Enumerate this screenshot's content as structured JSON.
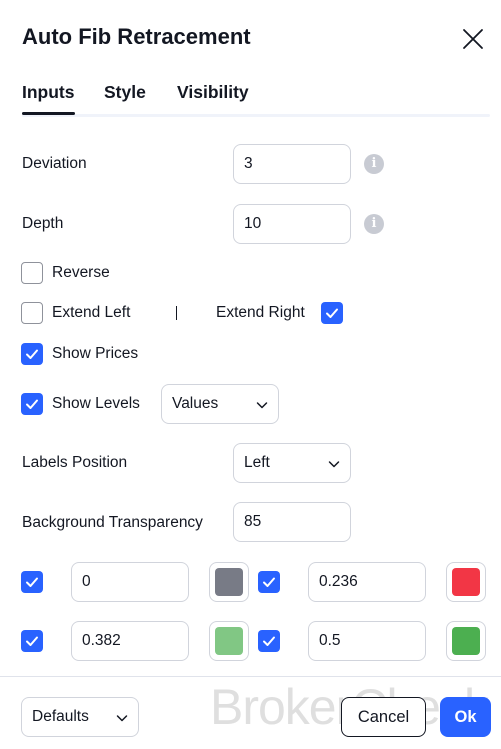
{
  "dialog": {
    "title": "Auto Fib Retracement"
  },
  "tabs": [
    {
      "label": "Inputs",
      "active": true
    },
    {
      "label": "Style",
      "active": false
    },
    {
      "label": "Visibility",
      "active": false
    }
  ],
  "inputs": {
    "deviation": {
      "label": "Deviation",
      "value": "3"
    },
    "depth": {
      "label": "Depth",
      "value": "10"
    },
    "reverse": {
      "label": "Reverse",
      "checked": false
    },
    "extend_left": {
      "label": "Extend Left",
      "checked": false
    },
    "separator": "|",
    "extend_right": {
      "label": "Extend Right",
      "checked": true
    },
    "show_prices": {
      "label": "Show Prices",
      "checked": true
    },
    "show_levels": {
      "label": "Show Levels",
      "checked": true,
      "selected": "Values"
    },
    "labels_position": {
      "label": "Labels Position",
      "selected": "Left"
    },
    "background_transparency": {
      "label": "Background Transparency",
      "value": "85"
    }
  },
  "levels": [
    {
      "checked": true,
      "value": "0",
      "color": "#787b86"
    },
    {
      "checked": true,
      "value": "0.236",
      "color": "#f23645"
    },
    {
      "checked": true,
      "value": "0.382",
      "color": "#81c784"
    },
    {
      "checked": true,
      "value": "0.5",
      "color": "#4caf50"
    }
  ],
  "footer": {
    "defaults_label": "Defaults",
    "cancel_label": "Cancel",
    "ok_label": "Ok"
  },
  "watermark": "BrokerCheck",
  "colors": {
    "accent": "#2962ff",
    "text": "#131722",
    "border": "#d1d4dc"
  }
}
